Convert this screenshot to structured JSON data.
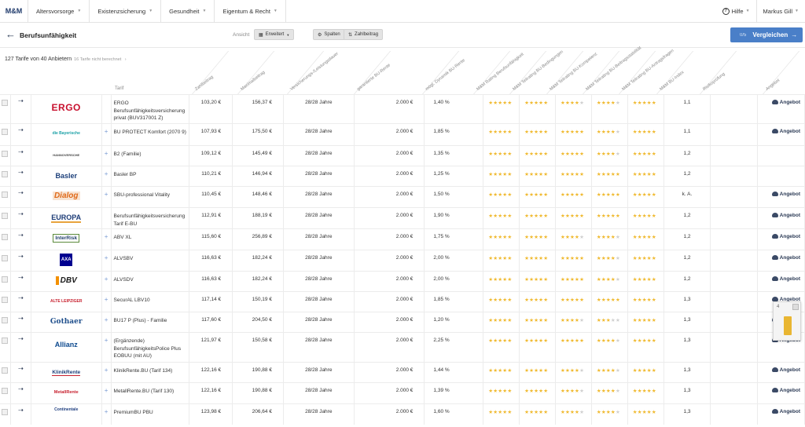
{
  "nav": {
    "logo": "M&M",
    "items": [
      "Altersvorsorge",
      "Existenzsicherung",
      "Gesundheit",
      "Eigentum & Recht"
    ],
    "help": "Hilfe",
    "user": "Markus Gill"
  },
  "toolbar": {
    "title": "Berufsunfähigkeit",
    "view_label": "Ansicht",
    "view_value": "Erweitert",
    "columns_label": "Spalten",
    "amount_label": "Zahlbeitrag",
    "compare_count": "0/5",
    "compare_label": "Vergleichen"
  },
  "summary": {
    "text": "127 Tarife von 40 Anbietern",
    "sub": "16 Tarife nicht berechnet"
  },
  "columns": [
    "Zahlbeitrag",
    "Maximalbeitrag",
    "Versicherungs-/Leistungsdauer",
    "garantierte BU-Rente",
    "mögl. Dynamik BU-Rente",
    "M&M Rating Berufsunfähigkeit",
    "M&M Teilrating BU-Bedingungen",
    "M&M Teilrating BU-Kompetenz",
    "M&M Teilrating BU-Beitragsstabilität",
    "M&M Teilrating BU-Antragsfragen",
    "M&M BU-Index",
    "Risikoprüfung",
    "Angebot"
  ],
  "tarif_label": "Tarif",
  "offer_label": "Angebot",
  "rows": [
    {
      "logo": "ERGO",
      "logo_class": "lg-ergo",
      "plus": false,
      "tarif": "ERGO Berufsunfähigkeitsversicherung privat (BUV317001 Z)",
      "zahl": "103,20 €",
      "max": "156,37 €",
      "dauer": "28/28 Jahre",
      "rente": "2.000 €",
      "dyn": "1,40 %",
      "stars": [
        5,
        5,
        4,
        4,
        5
      ],
      "index": "1,1",
      "offer": true
    },
    {
      "logo": "die Bayerische",
      "logo_class": "lg-bay",
      "plus": true,
      "tarif": "BU PROTECT Komfort (2070 9)",
      "zahl": "107,93 €",
      "max": "175,50 €",
      "dauer": "28/28 Jahre",
      "rente": "2.000 €",
      "dyn": "1,85 %",
      "stars": [
        5,
        5,
        5,
        4,
        5
      ],
      "index": "1,1",
      "offer": true
    },
    {
      "logo": "HANNOVERSCHE",
      "logo_class": "lg-han",
      "plus": true,
      "tarif": "B2 (Familie)",
      "zahl": "109,12 €",
      "max": "145,49 €",
      "dauer": "28/28 Jahre",
      "rente": "2.000 €",
      "dyn": "1,35 %",
      "stars": [
        5,
        5,
        5,
        4,
        5
      ],
      "index": "1,2",
      "offer": false
    },
    {
      "logo": "Basler",
      "logo_class": "lg-bas",
      "plus": true,
      "tarif": "Basler BP",
      "zahl": "110,21 €",
      "max": "146,94 €",
      "dauer": "28/28 Jahre",
      "rente": "2.000 €",
      "dyn": "1,25 %",
      "stars": [
        5,
        5,
        5,
        5,
        5
      ],
      "index": "1,2",
      "offer": false
    },
    {
      "logo": "Dialog",
      "logo_class": "lg-dia",
      "plus": true,
      "tarif": "SBU-professional Vitality",
      "zahl": "110,45 €",
      "max": "148,46 €",
      "dauer": "28/28 Jahre",
      "rente": "2.000 €",
      "dyn": "1,50 %",
      "stars": [
        5,
        5,
        5,
        5,
        5
      ],
      "index": "k. A.",
      "offer": true
    },
    {
      "logo": "EUROPA",
      "logo_class": "lg-eur",
      "plus": false,
      "tarif": "Berufsunfähigkeitsversicherung Tarif E-BU",
      "zahl": "112,91 €",
      "max": "188,19 €",
      "dauer": "28/28 Jahre",
      "rente": "2.000 €",
      "dyn": "1,90 %",
      "stars": [
        5,
        5,
        5,
        5,
        5
      ],
      "index": "1,2",
      "offer": true
    },
    {
      "logo": "InterRisk",
      "logo_class": "lg-int",
      "plus": true,
      "tarif": "ABV XL",
      "zahl": "115,60 €",
      "max": "256,89 €",
      "dauer": "28/28 Jahre",
      "rente": "2.000 €",
      "dyn": "1,75 %",
      "stars": [
        5,
        5,
        4,
        4,
        5
      ],
      "index": "1,2",
      "offer": true
    },
    {
      "logo": "AXA",
      "logo_class": "lg-axa",
      "plus": true,
      "tarif": "ALVSBV",
      "zahl": "116,63 €",
      "max": "182,24 €",
      "dauer": "28/28 Jahre",
      "rente": "2.000 €",
      "dyn": "2,00 %",
      "stars": [
        5,
        5,
        5,
        4,
        5
      ],
      "index": "1,2",
      "offer": true
    },
    {
      "logo": "DBV",
      "logo_class": "lg-dbv",
      "plus": true,
      "tarif": "ALVSDV",
      "zahl": "116,63 €",
      "max": "182,24 €",
      "dauer": "28/28 Jahre",
      "rente": "2.000 €",
      "dyn": "2,00 %",
      "stars": [
        5,
        5,
        5,
        4,
        5
      ],
      "index": "1,2",
      "offer": true
    },
    {
      "logo": "ALTE LEIPZIGER",
      "logo_class": "lg-alt",
      "plus": true,
      "tarif": "SecurAL LBV10",
      "zahl": "117,14 €",
      "max": "150,19 €",
      "dauer": "28/28 Jahre",
      "rente": "2.000 €",
      "dyn": "1,85 %",
      "stars": [
        5,
        5,
        5,
        5,
        5
      ],
      "index": "1,3",
      "offer": true
    },
    {
      "logo": "Gothaer",
      "logo_class": "lg-got",
      "plus": true,
      "tarif": "BU17 P (Plus) - Familie",
      "zahl": "117,60 €",
      "max": "204,50 €",
      "dauer": "28/28 Jahre",
      "rente": "2.000 €",
      "dyn": "1,20 %",
      "stars": [
        5,
        5,
        4,
        3,
        5
      ],
      "index": "1,3",
      "offer": true
    },
    {
      "logo": "Allianz",
      "logo_class": "lg-all",
      "plus": true,
      "tarif": "(Ergänzende) Berufsunfähigkeits­Police Plus EOBUU (mit AU)",
      "zahl": "121,97 €",
      "max": "150,58 €",
      "dauer": "28/28 Jahre",
      "rente": "2.000 €",
      "dyn": "2,25 %",
      "stars": [
        5,
        5,
        5,
        4,
        5
      ],
      "index": "1,3",
      "offer": true
    },
    {
      "logo": "KlinikRente",
      "logo_class": "lg-kli",
      "plus": true,
      "tarif": "KlinikRente.BU (Tarif 134)",
      "zahl": "122,16 €",
      "max": "190,88 €",
      "dauer": "28/28 Jahre",
      "rente": "2.000 €",
      "dyn": "1,44 %",
      "stars": [
        5,
        5,
        4,
        4,
        5
      ],
      "index": "1,3",
      "offer": true
    },
    {
      "logo": "MetallRente",
      "logo_class": "lg-met",
      "plus": true,
      "tarif": "MetallRente.BU (Tarif 130)",
      "zahl": "122,16 €",
      "max": "190,88 €",
      "dauer": "28/28 Jahre",
      "rente": "2.000 €",
      "dyn": "1,39 %",
      "stars": [
        5,
        5,
        4,
        4,
        5
      ],
      "index": "1,3",
      "offer": true
    },
    {
      "logo": "Continentale",
      "logo_class": "lg-con",
      "plus": true,
      "tarif": "PremiumBU PBU",
      "zahl": "123,98 €",
      "max": "206,64 €",
      "dauer": "28/28 Jahre",
      "rente": "2.000 €",
      "dyn": "1,60 %",
      "stars": [
        5,
        5,
        4,
        4,
        5
      ],
      "index": "1,3",
      "offer": true
    }
  ],
  "widget": {
    "label": "4"
  }
}
